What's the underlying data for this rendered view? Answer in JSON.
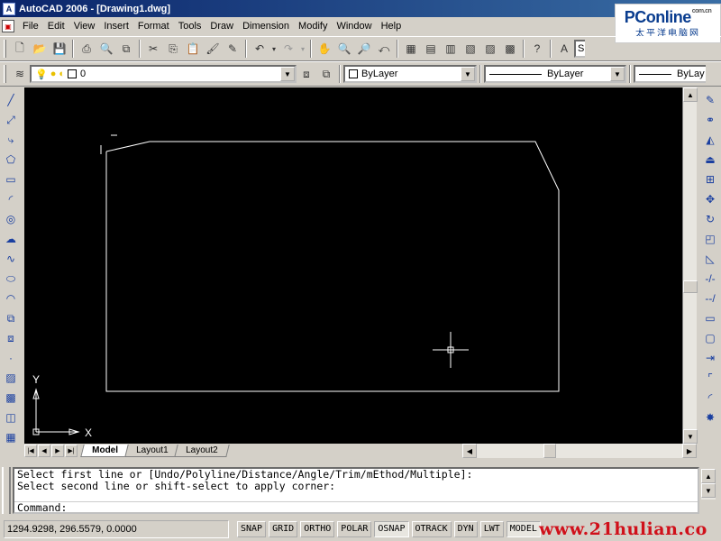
{
  "window": {
    "title": "AutoCAD 2006 - [Drawing1.dwg]"
  },
  "logo": {
    "brand": "PConline",
    "brand_suffix": "com.cn",
    "sub": "太平洋电脑网"
  },
  "menu": [
    {
      "label": "File"
    },
    {
      "label": "Edit"
    },
    {
      "label": "View"
    },
    {
      "label": "Insert"
    },
    {
      "label": "Format"
    },
    {
      "label": "Tools"
    },
    {
      "label": "Draw"
    },
    {
      "label": "Dimension"
    },
    {
      "label": "Modify"
    },
    {
      "label": "Window"
    },
    {
      "label": "Help"
    }
  ],
  "toolbar": {
    "text_style_partial": "S",
    "layer_value": "0",
    "color_value": "ByLayer",
    "linetype_value": "ByLayer",
    "lineweight_value": "ByLay"
  },
  "tabs": [
    {
      "label": "Model",
      "active": true
    },
    {
      "label": "Layout1",
      "active": false
    },
    {
      "label": "Layout2",
      "active": false
    }
  ],
  "ucs": {
    "x_label": "X",
    "y_label": "Y"
  },
  "command": {
    "history": [
      "Select first line or [Undo/Polyline/Distance/Angle/Trim/mEthod/Multiple]:",
      "Select second line or shift-select to apply corner:"
    ],
    "prompt": "Command:"
  },
  "status": {
    "coords": "1294.9298, 296.5579, 0.0000",
    "toggles": [
      {
        "label": "SNAP",
        "on": false
      },
      {
        "label": "GRID",
        "on": false
      },
      {
        "label": "ORTHO",
        "on": false
      },
      {
        "label": "POLAR",
        "on": false
      },
      {
        "label": "OSNAP",
        "on": true
      },
      {
        "label": "OTRACK",
        "on": false
      },
      {
        "label": "DYN",
        "on": false
      },
      {
        "label": "LWT",
        "on": false
      },
      {
        "label": "MODEL",
        "on": true
      }
    ]
  },
  "watermark": "www.21hulian.co",
  "colors": {
    "canvas": "#000000",
    "drawing": "#ffffff",
    "title_bar": "#0a246a",
    "watermark": "#d0101a"
  }
}
